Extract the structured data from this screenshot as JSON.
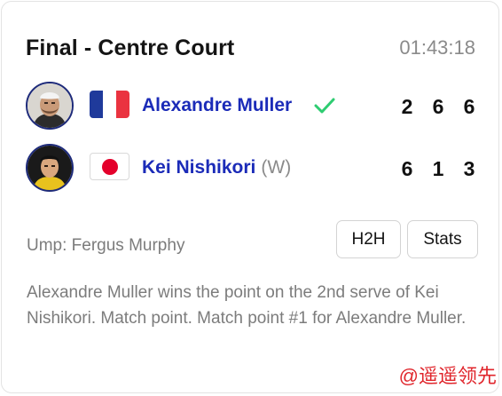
{
  "match": {
    "title": "Final - Centre Court",
    "clock": "01:43:18"
  },
  "players": [
    {
      "name": "Alexandre Muller",
      "suffix": "",
      "flag": "france-flag",
      "winner": true,
      "winner_icon": "check-icon",
      "scores": [
        "2",
        "6",
        "6"
      ]
    },
    {
      "name": "Kei Nishikori",
      "suffix": "(W)",
      "flag": "japan-flag",
      "winner": false,
      "scores": [
        "6",
        "1",
        "3"
      ]
    }
  ],
  "umpire": "Ump: Fergus Murphy",
  "buttons": {
    "h2h": "H2H",
    "stats": "Stats"
  },
  "commentary": "Alexandre Muller wins the point on the 2nd serve of Kei Nishikori. Match point. Match point #1 for Alexandre Muller.",
  "watermark": "@遥遥领先",
  "colors": {
    "player_name": "#1b2bb8",
    "winner_check": "#2ecc71",
    "muted_text": "#7c7c7c",
    "watermark": "#e0262c",
    "fr_blue": "#1f3a9b",
    "fr_white": "#ffffff",
    "fr_red": "#ea3340",
    "jp_red": "#e4002b"
  }
}
